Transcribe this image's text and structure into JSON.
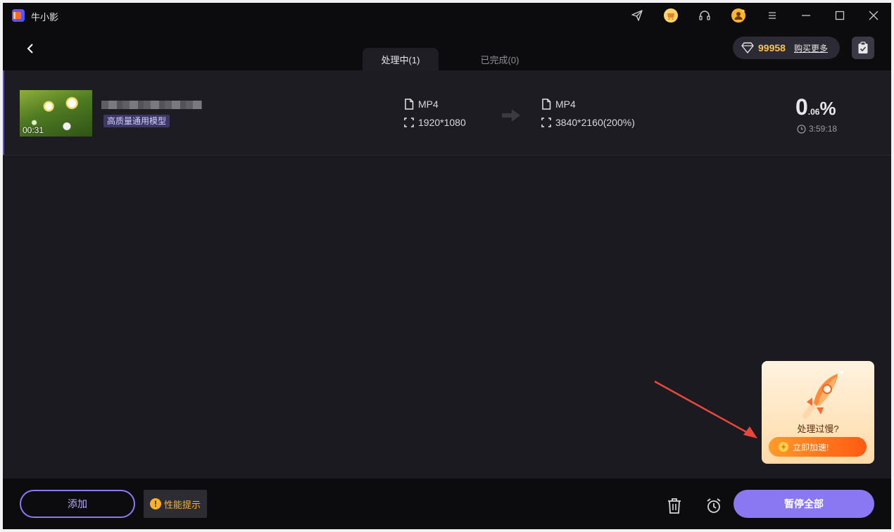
{
  "app": {
    "title": "牛小影"
  },
  "header": {
    "tabs": [
      {
        "label": "处理中(1)",
        "active": true
      },
      {
        "label": "已完成(0)",
        "active": false
      }
    ],
    "points": "99958",
    "buy_more": "购买更多"
  },
  "task": {
    "duration": "00:31",
    "model_tag": "高质量通用模型",
    "source": {
      "format": "MP4",
      "resolution": "1920*1080"
    },
    "target": {
      "format": "MP4",
      "resolution": "3840*2160(200%)"
    },
    "progress": {
      "whole": "0",
      "fraction": ".06",
      "unit": "%"
    },
    "eta": "3:59:18"
  },
  "promo": {
    "question": "处理过慢?",
    "button": "立即加速!"
  },
  "footer": {
    "add": "添加",
    "perf_tip": "性能提示",
    "pause_all": "暂停全部"
  },
  "colors": {
    "accent": "#8a78f3",
    "points": "#ffc24a",
    "warning": "#ffb02a",
    "promo_button": "#ff5a12"
  }
}
